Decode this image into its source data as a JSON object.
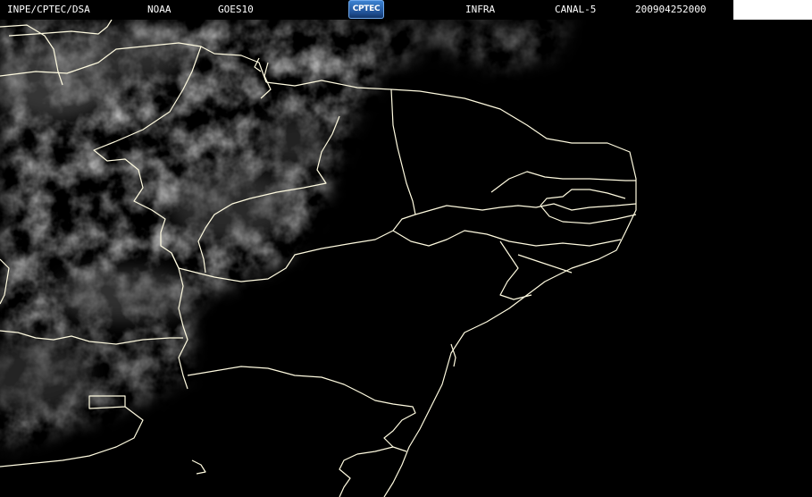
{
  "header": {
    "institution": "INPE/CPTEC/DSA",
    "agency": "NOAA",
    "satellite": "GOES10",
    "logo_text": "CPTEC",
    "product": "INFRA",
    "channel": "CANAL-5",
    "timestamp": "200904252000"
  },
  "map": {
    "type": "infrared satellite image",
    "boundary_color": "#fffbe0",
    "background_color": "#000000"
  }
}
